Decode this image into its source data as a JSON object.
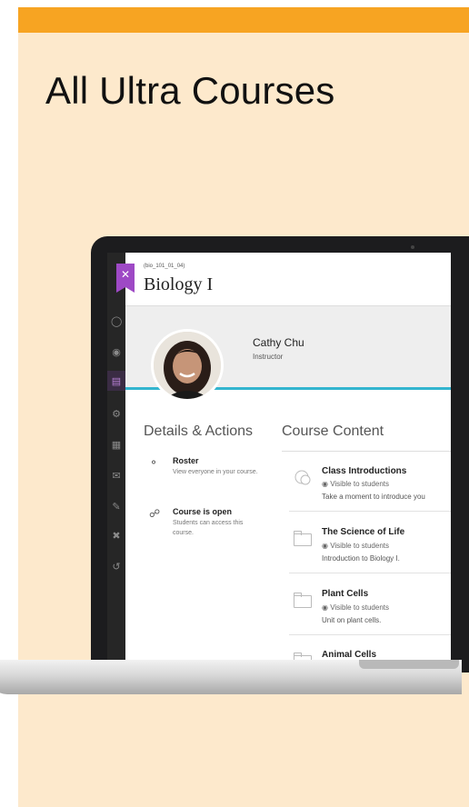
{
  "slide": {
    "title": "All Ultra Courses"
  },
  "course": {
    "id": "(bio_101_01_04)",
    "title": "Biology I"
  },
  "instructor": {
    "name": "Cathy Chu",
    "role": "Instructor"
  },
  "details": {
    "title": "Details & Actions",
    "roster_title": "Roster",
    "roster_sub": "View everyone in your course.",
    "open_title": "Course is open",
    "open_sub": "Students can access this course."
  },
  "content": {
    "title": "Course Content",
    "items": [
      {
        "title": "Class Introductions",
        "visibility": "Visible to students",
        "desc": "Take a moment to introduce you"
      },
      {
        "title": "The Science of Life",
        "visibility": "Visible to students",
        "desc": "Introduction to Biology I."
      },
      {
        "title": "Plant Cells",
        "visibility": "Visible to students",
        "desc": "Unit on plant cells."
      },
      {
        "title": "Animal Cells",
        "visibility": "",
        "desc": ""
      }
    ]
  },
  "icons": {
    "close": "close-icon",
    "sidebar": [
      "user-icon",
      "globe-icon",
      "courses-icon",
      "groups-icon",
      "calendar-icon",
      "messages-icon",
      "grades-icon",
      "tools-icon",
      "signout-icon"
    ]
  },
  "colors": {
    "orange": "#f7a422",
    "background": "#fde9cc",
    "purple": "#9e49c5",
    "teal": "#33b5cf"
  }
}
